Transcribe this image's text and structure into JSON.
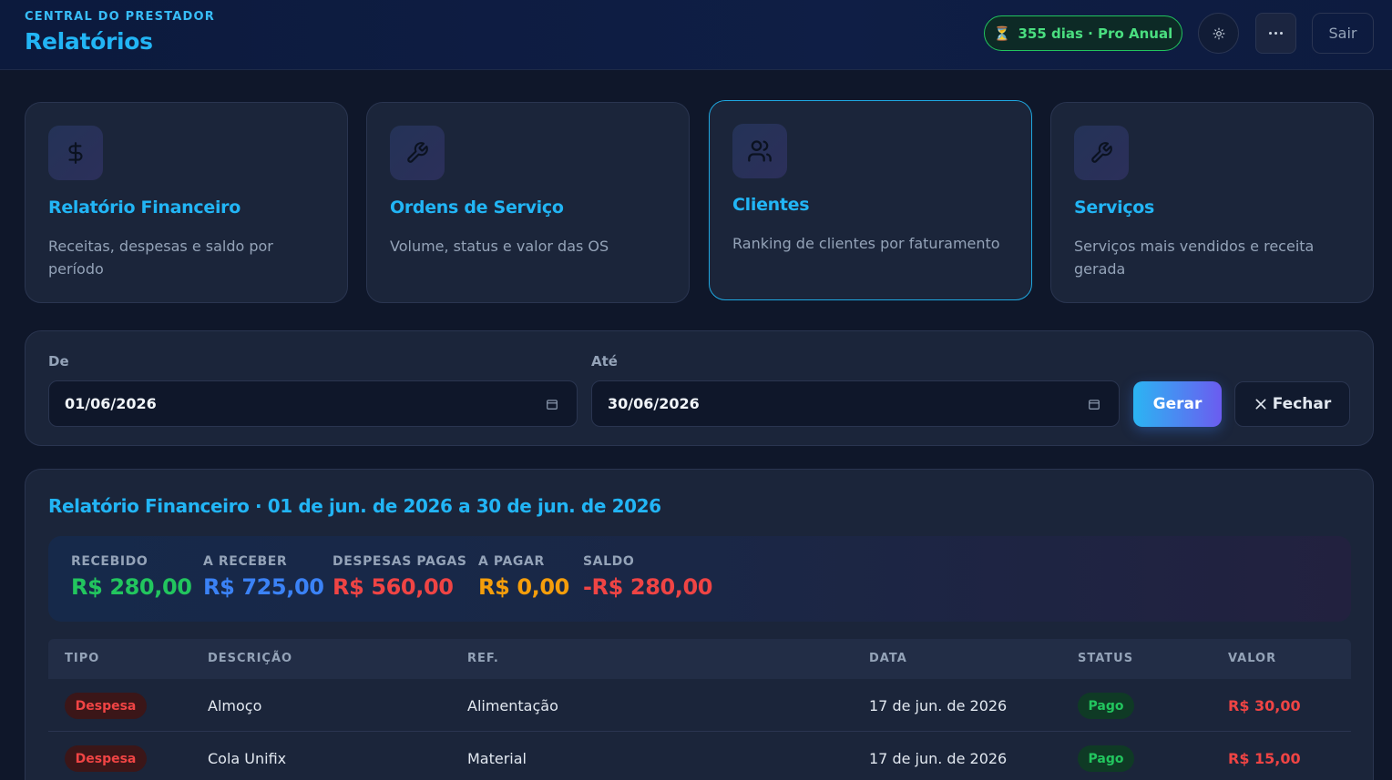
{
  "header": {
    "eyebrow": "CENTRAL DO PRESTADOR",
    "title": "Relatórios",
    "plan_badge": "355 dias · Pro Anual",
    "logout_label": "Sair"
  },
  "report_types": [
    {
      "title": "Relatório Financeiro",
      "description": "Receitas, despesas e saldo por período",
      "icon": "dollar-icon"
    },
    {
      "title": "Ordens de Serviço",
      "description": "Volume, status e valor das OS",
      "icon": "wrench-icon"
    },
    {
      "title": "Clientes",
      "description": "Ranking de clientes por faturamento",
      "icon": "users-icon",
      "active": true
    },
    {
      "title": "Serviços",
      "description": "Serviços mais vendidos e receita gerada",
      "icon": "wrench-icon"
    }
  ],
  "filter": {
    "from_label": "De",
    "from_value": "01/06/2026",
    "to_label": "Até",
    "to_value": "30/06/2026",
    "generate_label": "Gerar",
    "close_label": "Fechar"
  },
  "report": {
    "title": "Relatório Financeiro · 01 de jun. de 2026 a 30 de jun. de 2026",
    "summary": [
      {
        "label": "RECEBIDO",
        "value": "R$ 280,00",
        "color": "#22c55e"
      },
      {
        "label": "A RECEBER",
        "value": "R$ 725,00",
        "color": "#3b82f6"
      },
      {
        "label": "DESPESAS PAGAS",
        "value": "R$ 560,00",
        "color": "#ef4444"
      },
      {
        "label": "A PAGAR",
        "value": "R$ 0,00",
        "color": "#f59e0b"
      },
      {
        "label": "SALDO",
        "value": "-R$ 280,00",
        "color": "#ef4444"
      }
    ],
    "columns": [
      "TIPO",
      "DESCRIÇÃO",
      "REF.",
      "DATA",
      "STATUS",
      "VALOR"
    ],
    "rows": [
      {
        "type": "Despesa",
        "description": "Almoço",
        "ref": "Alimentação",
        "date": "17 de jun. de 2026",
        "status": "Pago",
        "value": "R$ 30,00"
      },
      {
        "type": "Despesa",
        "description": "Cola Unifix",
        "ref": "Material",
        "date": "17 de jun. de 2026",
        "status": "Pago",
        "value": "R$ 15,00"
      }
    ]
  }
}
